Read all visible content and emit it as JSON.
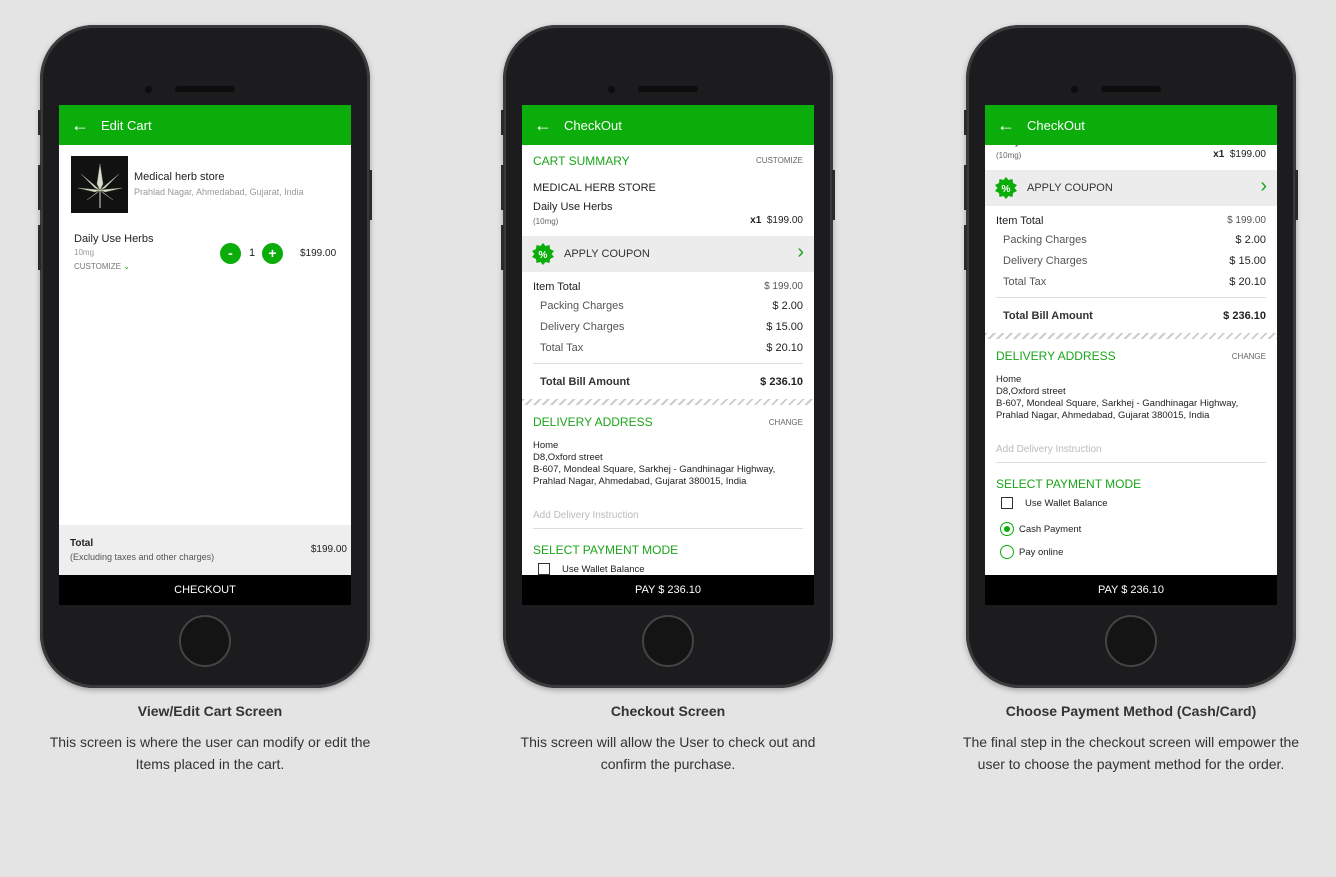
{
  "colors": {
    "brand": "#0aad0a",
    "background": "#e4e4e4"
  },
  "edit_cart": {
    "header_title": "Edit Cart",
    "store_name": "Medical herb store",
    "store_address": "Prahlad Nagar, Ahmedabad, Gujarat, India",
    "item": {
      "name": "Daily Use Herbs",
      "weight": "10mg",
      "customize": "CUSTOMIZE",
      "quantity": "1",
      "price": "$199.00",
      "minus": "-",
      "plus": "+"
    },
    "total_label": "Total",
    "total_note": "(Excluding taxes and other charges)",
    "total_value": "$199.00",
    "checkout_button": "CHECKOUT"
  },
  "checkout": {
    "header_title": "CheckOut",
    "cart_summary": "CART SUMMARY",
    "customize": "CUSTOMIZE",
    "store": "MEDICAL HERB STORE",
    "item_name": "Daily Use Herbs",
    "item_weight": "(10mg)",
    "item_qty": "x1",
    "item_price": "$199.00",
    "apply_coupon": "APPLY COUPON",
    "bill": {
      "item_total_label": "Item Total",
      "item_total": "$ 199.00",
      "packing_label": "Packing Charges",
      "packing": "$ 2.00",
      "delivery_label": "Delivery Charges",
      "delivery": "$ 15.00",
      "tax_label": "Total Tax",
      "tax": "$ 20.10",
      "total_label": "Total Bill Amount",
      "total": "$ 236.10"
    },
    "delivery_address_title": "DELIVERY ADDRESS",
    "change": "CHANGE",
    "address": [
      "Home",
      "D8,Oxford street",
      "B-607,  Mondeal Square,  Sarkhej - Gandhinagar Highway,",
      "Prahlad Nagar,  Ahmedabad,  Gujarat 380015,  India"
    ],
    "instruction_placeholder": "Add Delivery Instruction",
    "payment_title": "SELECT PAYMENT MODE",
    "payment_options": {
      "wallet": "Use Wallet Balance",
      "cash": "Cash Payment",
      "online": "Pay online"
    },
    "selected_payment": "Cash Payment",
    "pay_button": "PAY $ 236.10"
  },
  "captions": [
    {
      "title": "View/Edit Cart Screen",
      "lines": [
        "This screen is where the user can modify or edit the",
        "Items placed in the cart."
      ]
    },
    {
      "title": "Checkout Screen",
      "lines": [
        "This screen will allow the User to check out and",
        "confirm the purchase."
      ]
    },
    {
      "title": "Choose Payment Method (Cash/Card)",
      "lines": [
        "The final step in the checkout screen will empower the",
        "user to choose the payment method for the order."
      ]
    }
  ]
}
